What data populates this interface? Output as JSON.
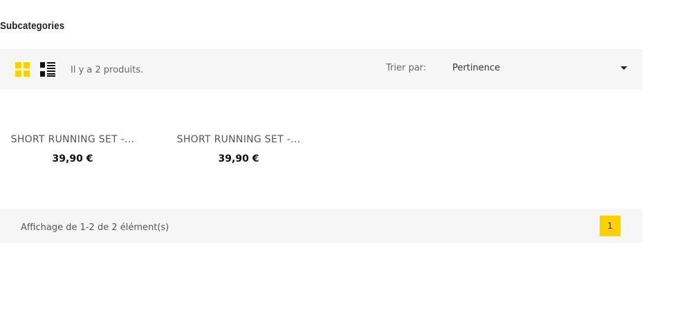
{
  "section": {
    "title": "Subcategories"
  },
  "toolbar": {
    "product_count_text": "Il y a 2 produits.",
    "sort_label": "Trier par:",
    "sort_value": "Pertinence",
    "active_view": "grid",
    "accent_color": "#ffd000"
  },
  "products": [
    {
      "name": "SHORT RUNNING SET -...",
      "price": "39,90 €"
    },
    {
      "name": "SHORT RUNNING SET -...",
      "price": "39,90 €"
    }
  ],
  "footer": {
    "showing_text": "Affichage de 1-2 de 2 élément(s)",
    "current_page": "1"
  },
  "icons": {
    "grid_view": "grid-view-icon",
    "list_view": "list-view-icon",
    "sort_caret": "caret-down-icon"
  }
}
